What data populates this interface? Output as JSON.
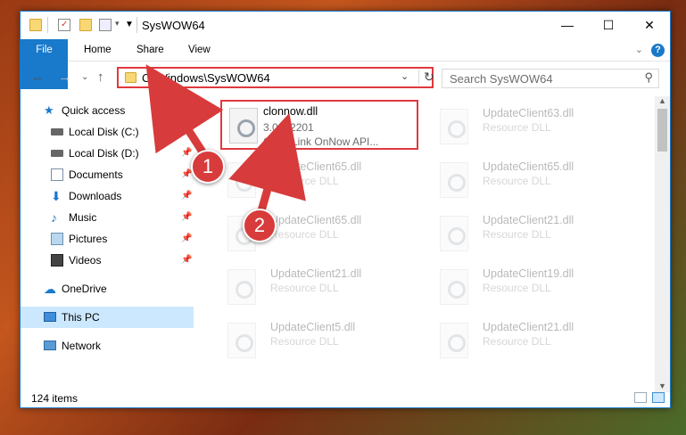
{
  "window": {
    "title": "SysWOW64",
    "controls": {
      "minimize": "—",
      "maximize": "☐",
      "close": "✕"
    }
  },
  "ribbon": {
    "tabs": [
      "File",
      "Home",
      "Share",
      "View"
    ],
    "help": "?"
  },
  "nav": {
    "address": "C:\\Windows\\SysWOW64",
    "search_placeholder": "Search SysWOW64"
  },
  "sidebar": {
    "items": [
      {
        "label": "Quick access",
        "icon": "star-icon"
      },
      {
        "label": "Local Disk (C:)",
        "icon": "drive-icon",
        "pinned": true
      },
      {
        "label": "Local Disk (D:)",
        "icon": "drive-icon",
        "pinned": true
      },
      {
        "label": "Documents",
        "icon": "documents-icon",
        "pinned": true
      },
      {
        "label": "Downloads",
        "icon": "download-icon",
        "pinned": true
      },
      {
        "label": "Music",
        "icon": "music-icon",
        "pinned": true
      },
      {
        "label": "Pictures",
        "icon": "pictures-icon",
        "pinned": true
      },
      {
        "label": "Videos",
        "icon": "videos-icon",
        "pinned": true
      },
      {
        "label": "OneDrive",
        "icon": "cloud-icon"
      },
      {
        "label": "This PC",
        "icon": "computer-icon",
        "selected": true
      },
      {
        "label": "Network",
        "icon": "network-icon"
      }
    ]
  },
  "files": {
    "highlighted": {
      "name": "clonnow.dll",
      "version": "3.0.0.2201",
      "desc": "CyberLink OnNow API..."
    },
    "others": [
      {
        "name": "UpdateClient63.dll",
        "type": "Resource DLL"
      },
      {
        "name": "UpdateClient65.dll",
        "type": "Resource DLL"
      },
      {
        "name": "UpdateClient65.dll",
        "type": "Resource DLL"
      },
      {
        "name": "UpdateClient65.dll",
        "type": "Resource DLL"
      },
      {
        "name": "UpdateClient21.dll",
        "type": "Resource DLL"
      },
      {
        "name": "UpdateClient21.dll",
        "type": "Resource DLL"
      },
      {
        "name": "UpdateClient19.dll",
        "type": "Resource DLL"
      },
      {
        "name": "UpdateClient5.dll",
        "type": "Resource DLL"
      },
      {
        "name": "UpdateClient21.dll",
        "type": "Resource DLL"
      }
    ]
  },
  "status": {
    "count": "124 items"
  },
  "annotations": {
    "step1": "1",
    "step2": "2"
  },
  "colors": {
    "accent": "#1979ca",
    "highlight": "#e0393e",
    "selected": "#cce8ff"
  }
}
